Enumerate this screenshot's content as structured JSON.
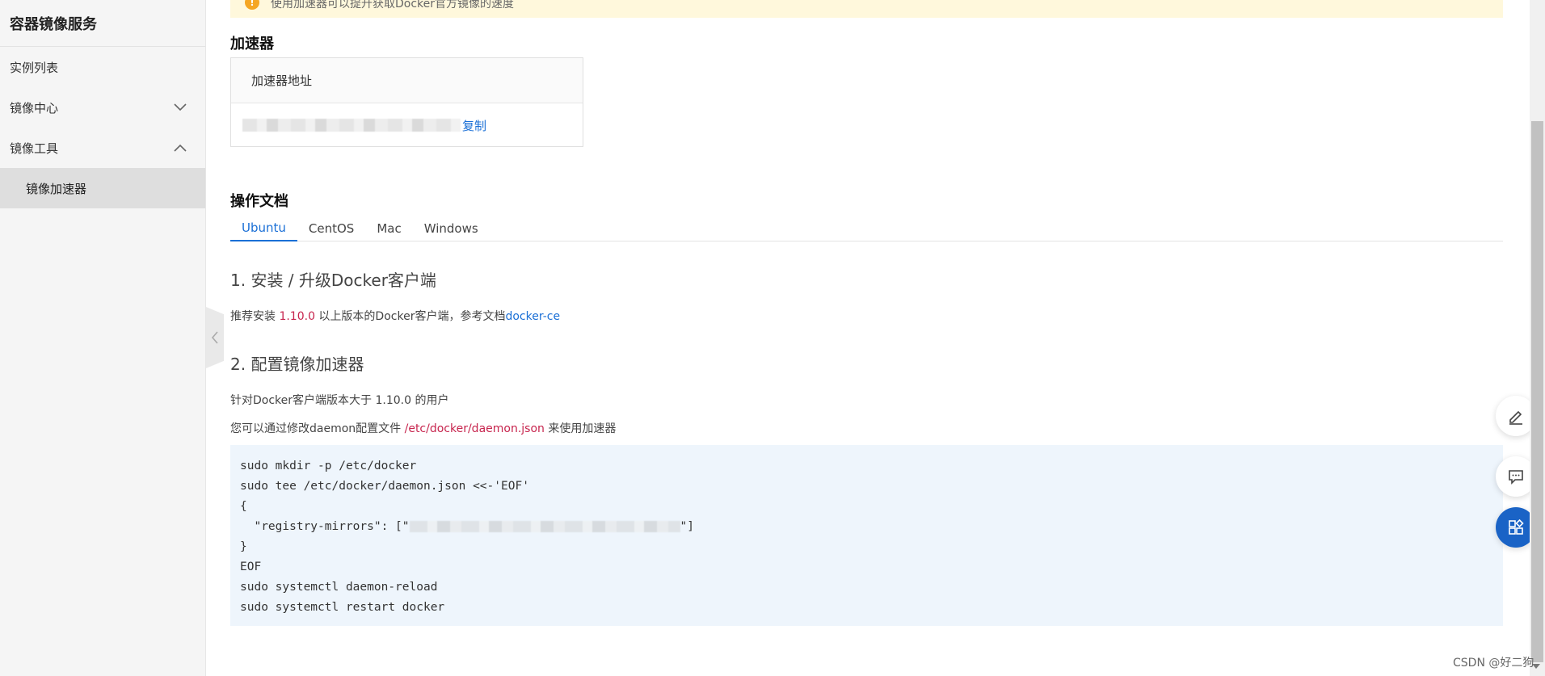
{
  "sidebar": {
    "title": "容器镜像服务",
    "items": [
      {
        "label": "实例列表"
      },
      {
        "label": "镜像中心",
        "expanded": false
      },
      {
        "label": "镜像工具",
        "expanded": true
      }
    ],
    "sub_item": "镜像加速器"
  },
  "notice": {
    "text": "使用加速器可以提升获取Docker官方镜像的速度"
  },
  "accelerator": {
    "section_title": "加速器",
    "header": "加速器地址",
    "copy_label": "复制"
  },
  "docs": {
    "section_title": "操作文档",
    "tabs": [
      "Ubuntu",
      "CentOS",
      "Mac",
      "Windows"
    ],
    "active_tab": "Ubuntu",
    "step1_title": "1. 安装 / 升级Docker客户端",
    "step1_text_a": "推荐安装 ",
    "step1_version": "1.10.0",
    "step1_text_b": " 以上版本的Docker客户端，参考文档",
    "step1_link": "docker-ce",
    "step2_title": "2. 配置镜像加速器",
    "step2_line1": "针对Docker客户端版本大于 1.10.0 的用户",
    "step2_line2_a": "您可以通过修改daemon配置文件 ",
    "step2_path": "/etc/docker/daemon.json",
    "step2_line2_b": " 来使用加速器",
    "code": {
      "line1": "sudo mkdir -p /etc/docker",
      "line2": "sudo tee /etc/docker/daemon.json <<-'EOF'",
      "line3": "{",
      "line4_a": "  \"registry-mirrors\": [\"",
      "line4_b": "\"]",
      "line5": "}",
      "line6": "EOF",
      "line7": "sudo systemctl daemon-reload",
      "line8": "sudo systemctl restart docker"
    }
  },
  "watermark": "CSDN @好二狗",
  "colors": {
    "accent": "#1a6fd6",
    "highlight": "#c7254e",
    "code_bg": "#eef5fc",
    "notice_bg": "#fff8dc"
  },
  "icons": {
    "edit": "pencil-icon",
    "feedback": "chat-icon",
    "apps": "apps-icon"
  }
}
